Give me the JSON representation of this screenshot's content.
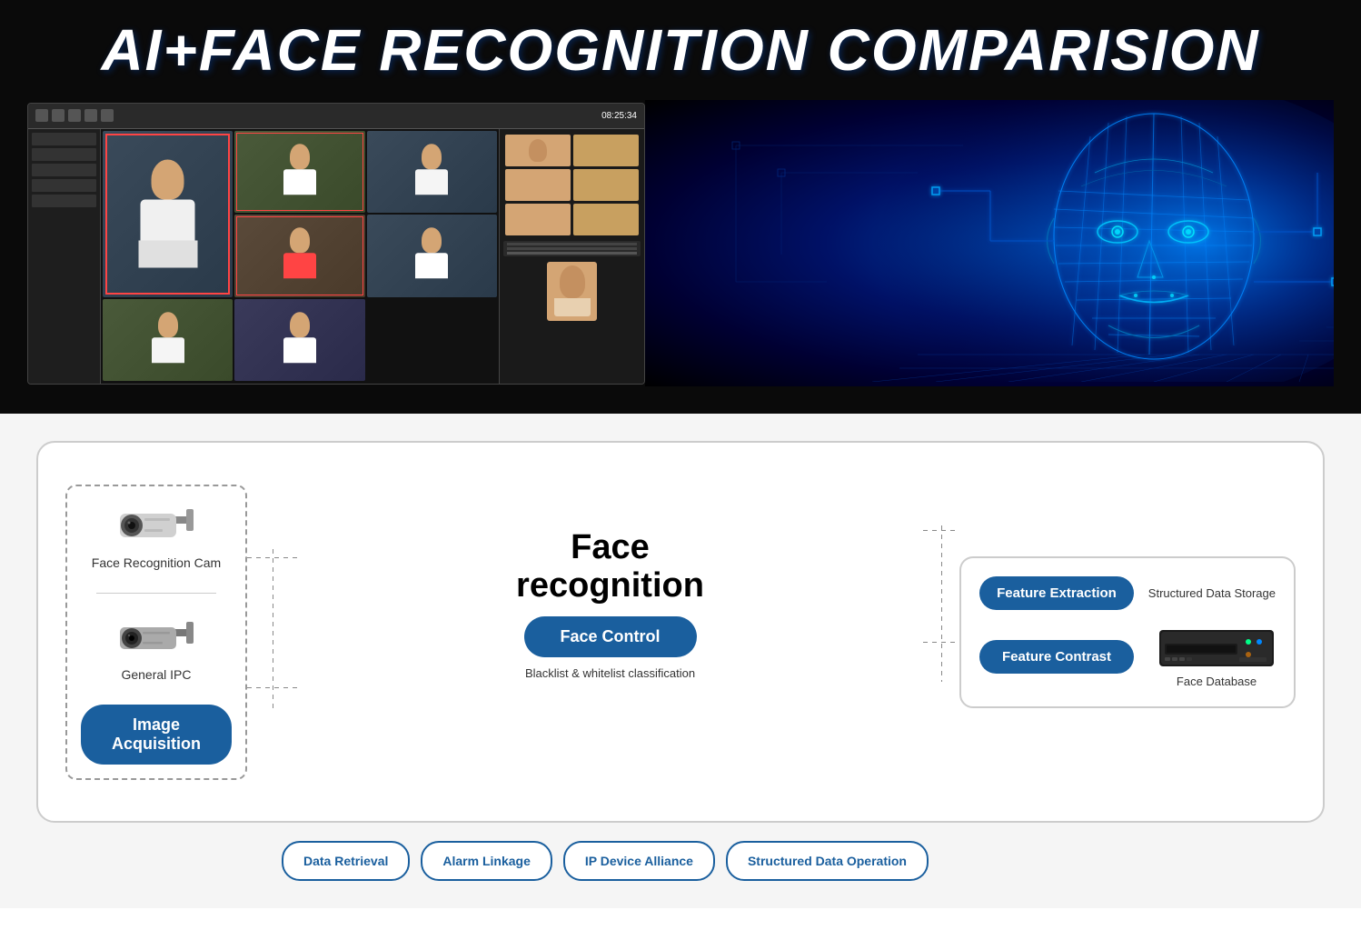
{
  "page": {
    "title": "AI+FACE RECOGNITION COMPARISION",
    "top_section": {
      "mockup": {
        "time": "08:25:34"
      },
      "ai_face": {
        "alt": "AI wireframe face graphic"
      }
    },
    "bottom_section": {
      "diagram": {
        "left_box": {
          "cam1": {
            "label": "Face Recognition Cam"
          },
          "cam2": {
            "label": "General IPC"
          },
          "image_acquisition_btn": "Image Acquisition"
        },
        "center": {
          "title_line1": "Face",
          "title_line2": "recognition",
          "face_control_btn": "Face Control",
          "blacklist_text": "Blacklist & whitelist classification"
        },
        "right_box": {
          "structured_data_storage_label": "Structured Data Storage",
          "feature_extraction_btn": "Feature Extraction",
          "feature_contrast_btn": "Feature Contrast",
          "face_database_label": "Face Database",
          "nvr_alt": "NVR device"
        },
        "bottom_row": {
          "btn1": "Data Retrieval",
          "btn2": "Alarm Linkage",
          "btn3": "IP Device Alliance",
          "btn4": "Structured Data Operation"
        }
      }
    }
  }
}
